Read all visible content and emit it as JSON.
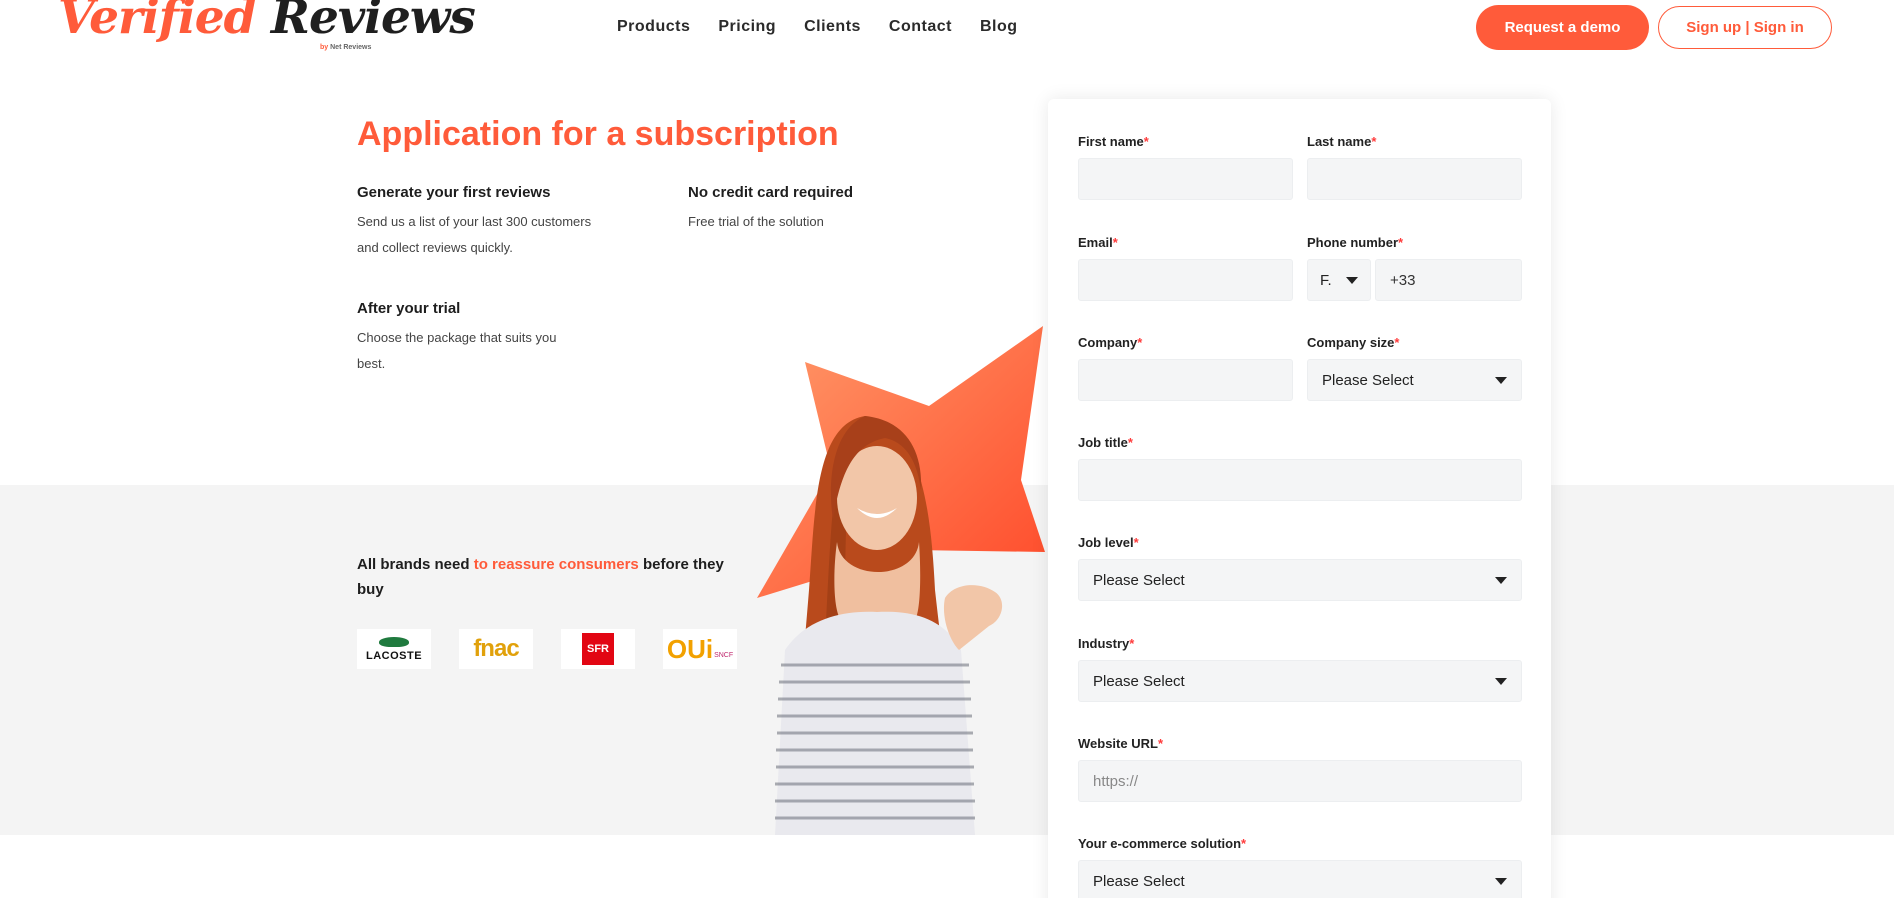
{
  "header": {
    "logo_main_1": "Verified",
    "logo_main_2": "Reviews",
    "logo_by": "by",
    "logo_sub": "Net Reviews",
    "nav": [
      "Products",
      "Pricing",
      "Clients",
      "Contact",
      "Blog"
    ],
    "demo_button": "Request a demo",
    "sign_button": "Sign up | Sign in"
  },
  "intro": {
    "title": "Application for a subscription",
    "features": [
      {
        "title": "Generate your first reviews",
        "text": "Send us a list of your last 300 customers and collect reviews quickly."
      },
      {
        "title": "No credit card required",
        "text": "Free trial of the solution"
      },
      {
        "title": "After your trial",
        "text": "Choose the package that suits you best."
      }
    ]
  },
  "brands": {
    "text_before": "All brands need ",
    "text_highlight": "to reassure consumers",
    "text_after": " before they buy",
    "logos": [
      "LACOSTE",
      "fnac",
      "SFR",
      "OUi",
      "SNCF"
    ]
  },
  "form": {
    "required_mark": "*",
    "first_name_label": "First name",
    "last_name_label": "Last name",
    "email_label": "Email",
    "phone_label": "Phone number",
    "phone_country": "F.",
    "phone_code": "+33",
    "company_label": "Company",
    "company_size_label": "Company size",
    "company_size_value": "Please Select",
    "job_title_label": "Job title",
    "job_level_label": "Job level",
    "job_level_value": "Please Select",
    "industry_label": "Industry",
    "industry_value": "Please Select",
    "website_label": "Website URL",
    "website_placeholder": "https://",
    "ecommerce_label": "Your e-commerce solution",
    "ecommerce_value": "Please Select"
  },
  "colors": {
    "accent": "#ff5b3a",
    "band": "#f4f4f4",
    "input_bg": "#f4f5f6"
  },
  "icons": [
    "chevron-down-icon",
    "star-shape",
    "person-photo"
  ]
}
